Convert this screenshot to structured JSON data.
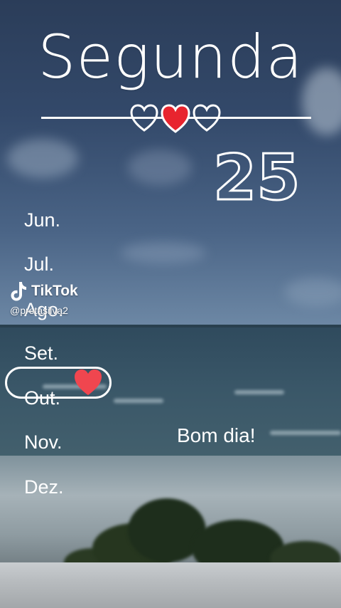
{
  "header": {
    "day_name": "Segunda",
    "day_number": "25"
  },
  "months": [
    "Jun.",
    "Jul.",
    "Ago.",
    "Set.",
    "Out.",
    "Nov.",
    "Dez."
  ],
  "selected_month": "Out.",
  "greeting": "Bom dia!",
  "watermark": {
    "brand": "TikTok",
    "handle": "@pretasilva2"
  },
  "colors": {
    "heart_red": "#e8242e",
    "text": "#ffffff"
  },
  "icons": [
    "heart-outline-icon",
    "heart-filled-icon",
    "tiktok-note-icon"
  ]
}
